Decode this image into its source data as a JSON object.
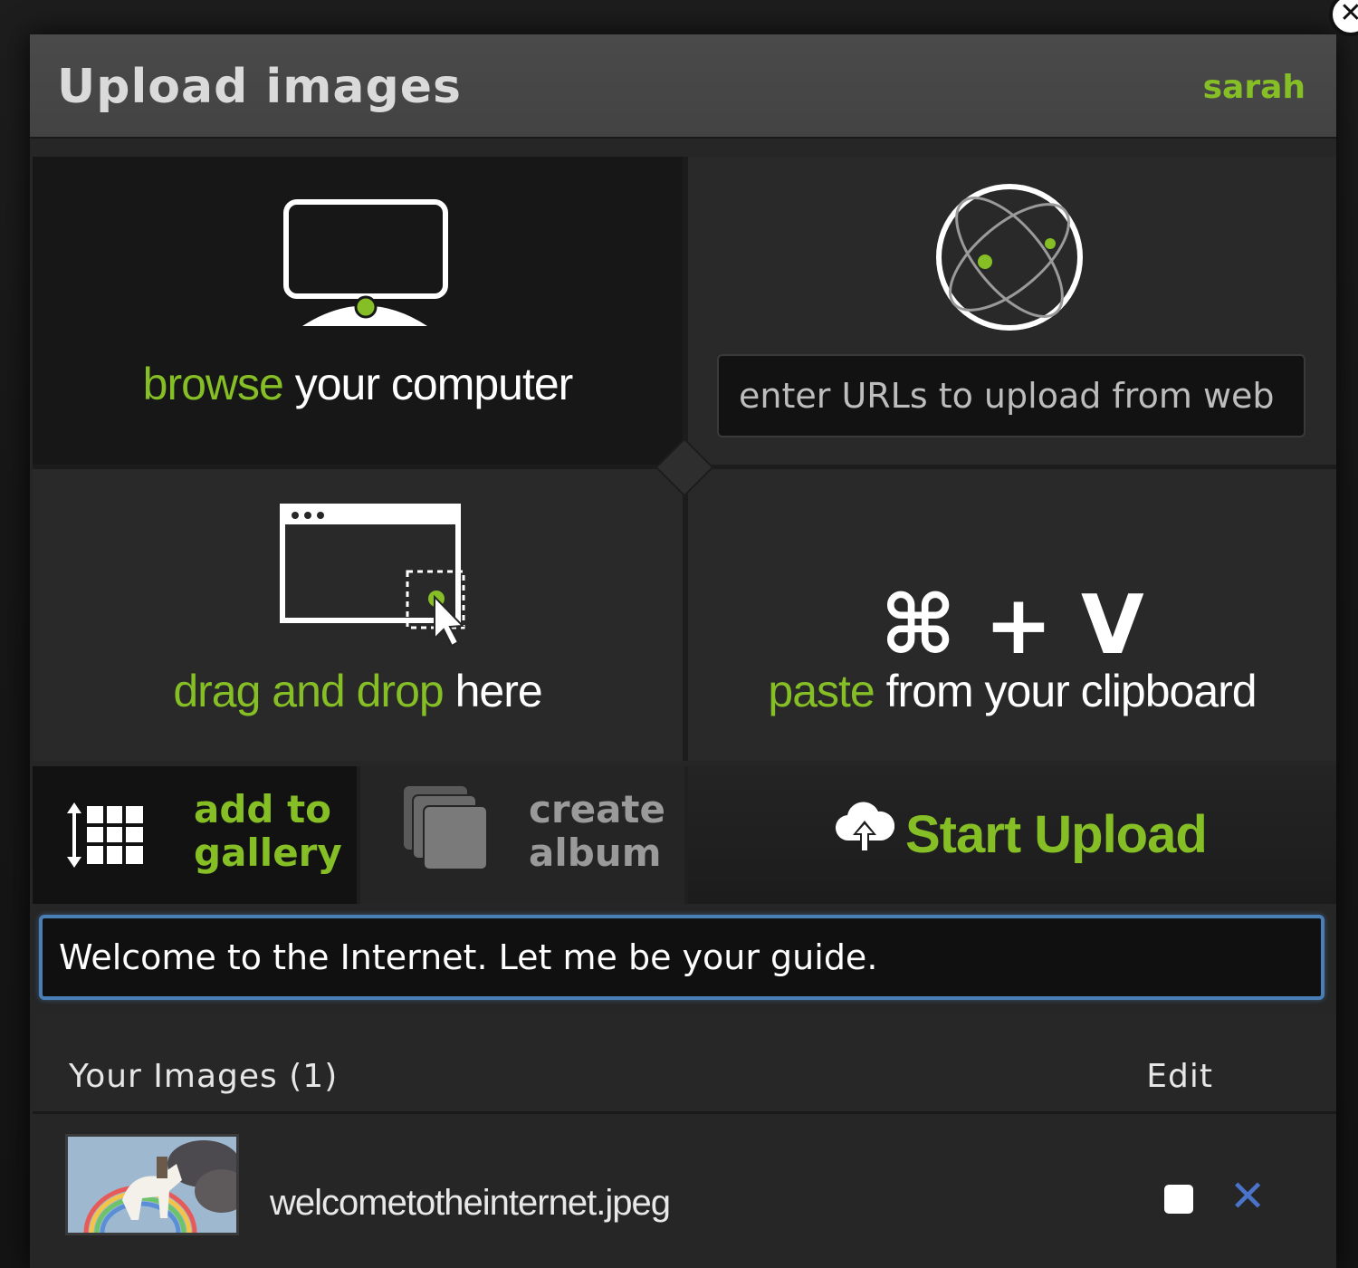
{
  "header": {
    "title": "Upload images",
    "user": "sarah",
    "close_symbol": "✕"
  },
  "browse": {
    "highlight": "browse",
    "rest": " your computer",
    "icon": "monitor-icon"
  },
  "url": {
    "icon": "globe-icon",
    "placeholder": "enter URLs to upload from web"
  },
  "drag": {
    "highlight": "drag and drop",
    "rest": " here",
    "icon": "browser-window-icon"
  },
  "paste": {
    "keys": "⌘ + V",
    "highlight": "paste",
    "rest": " from your clipboard"
  },
  "actions": {
    "gallery_line1": "add to",
    "gallery_line2": "gallery",
    "album_line1": "create",
    "album_line2": "album",
    "upload": "Start Upload"
  },
  "caption": {
    "value": "Welcome to the Internet. Let me be your guide."
  },
  "images": {
    "title": "Your Images (1)",
    "edit": "Edit",
    "items": [
      {
        "filename": "welcometotheinternet.jpeg",
        "remove_symbol": "✕"
      }
    ]
  },
  "colors": {
    "accent": "#85bf25",
    "focus_border": "#4a7fb5",
    "remove": "#4a74c9"
  }
}
